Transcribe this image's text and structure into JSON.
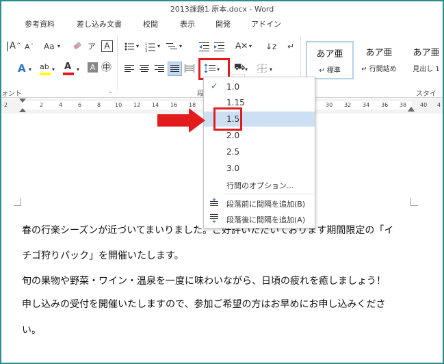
{
  "window": {
    "title": "2013課題1  原本.docx - Word"
  },
  "ribbon_tabs": [
    "参考資料",
    "差し込み文書",
    "校閲",
    "表示",
    "開発",
    "アドイン"
  ],
  "ribbon": {
    "font_group_label": "ォント",
    "paragraph_group_label": "段",
    "style_group_label": "スタイル",
    "styles": [
      {
        "sample": "あア亜",
        "name": "↵ 標準"
      },
      {
        "sample": "あア亜",
        "name": "↵ 行間詰め"
      },
      {
        "sample": "あア亜",
        "name": "見出し 1"
      }
    ],
    "icons": {
      "grow_font": "A",
      "shrink_font": "A",
      "change_case": "Aa",
      "text_effects": "A",
      "highlight": "ab",
      "font_color": "A",
      "char_border": "A",
      "enclose_char": "㊥",
      "line_spacing_selected": true
    }
  },
  "ruler_numbers": [
    "2",
    "2",
    "4",
    "6",
    "8",
    "10",
    "12",
    "14",
    "16",
    "18",
    "20",
    "22",
    "24",
    "26",
    "28",
    "30",
    "32",
    "34",
    "36",
    "38",
    "40",
    "42",
    "4"
  ],
  "line_spacing_menu": {
    "options": [
      "1.0",
      "1.15",
      "1.5",
      "2.0",
      "2.5",
      "3.0"
    ],
    "checked": "1.0",
    "highlighted": "1.5",
    "more_options": "行間のオプション...",
    "add_before": "段落前に間隔を追加(B)",
    "add_after": "段落後に間隔を追加(A)"
  },
  "document": {
    "lines": [
      "春の行楽シーズンが近づいてまいりました。ご好評いただいております期間限定の「イ",
      "チゴ狩りパック」を開催いたします。",
      "旬の果物や野菜・ワイン・温泉を一度に味わいながら、日頃の疲れを癒しましょう！",
      "申し込みの受付を開催いたしますので、参加ご希望の方はお早めにお申し込みくださ",
      "い。"
    ]
  },
  "colors": {
    "accent_red": "#e21c1c",
    "border_teal": "#2a8c8c",
    "highlight": "#cde0f3"
  }
}
